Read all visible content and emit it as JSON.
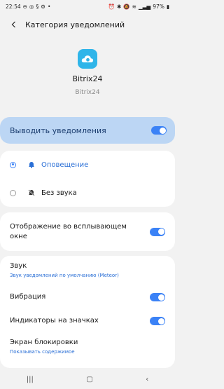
{
  "status_bar": {
    "time": "22:54",
    "battery": "97%"
  },
  "header": {
    "title": "Категория уведомлений"
  },
  "app": {
    "name": "Bitrix24",
    "subtitle": "Bitrix24",
    "icon_color": "#2fb5e9"
  },
  "master": {
    "label": "Выводить уведомления",
    "enabled": true
  },
  "mode": {
    "options": [
      {
        "label": "Оповещение",
        "icon": "bell-icon",
        "selected": true
      },
      {
        "label": "Без звука",
        "icon": "bell-off-icon",
        "selected": false
      }
    ]
  },
  "popup": {
    "label": "Отображение во всплывающем окне",
    "enabled": true
  },
  "settings": {
    "sound": {
      "label": "Звук",
      "value": "Звук уведомлений по умолчанию (Meteor)"
    },
    "vibration": {
      "label": "Вибрация",
      "enabled": true
    },
    "badges": {
      "label": "Индикаторы на значках",
      "enabled": true
    },
    "lock_screen": {
      "label": "Экран блокировки",
      "value": "Показывать содержимое"
    }
  },
  "colors": {
    "accent": "#3b82f6",
    "master_bg": "#bcd6f4"
  }
}
